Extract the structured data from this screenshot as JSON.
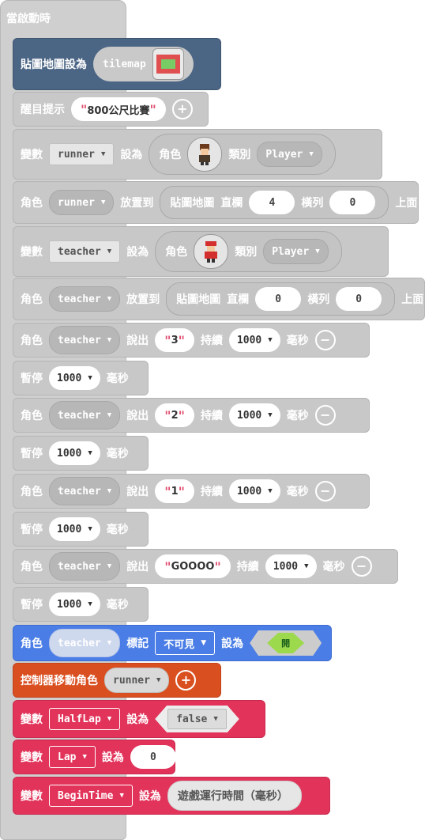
{
  "hat": {
    "label": "當啟動時"
  },
  "tilemap_block": {
    "label": "貼圖地圖設為",
    "value": "tilemap",
    "colors": {
      "tile": "#e05050",
      "center": "#77cc66"
    }
  },
  "title_block": {
    "label": "醒目提示",
    "text": "800公尺比賽"
  },
  "runner_set": {
    "var_label": "變數",
    "var": "runner",
    "set_label": "設為",
    "sprite_label": "角色",
    "kind_label": "類別",
    "kind": "Player"
  },
  "runner_place": {
    "sprite_label": "角色",
    "var": "runner",
    "place_label": "放置到",
    "tilemap_label": "貼圖地圖",
    "col_label": "直欄",
    "col": "4",
    "row_label": "橫列",
    "row": "0",
    "top_label": "上面"
  },
  "teacher_set": {
    "var_label": "變數",
    "var": "teacher",
    "set_label": "設為",
    "sprite_label": "角色",
    "kind_label": "類別",
    "kind": "Player"
  },
  "teacher_place": {
    "sprite_label": "角色",
    "var": "teacher",
    "place_label": "放置到",
    "tilemap_label": "貼圖地圖",
    "col_label": "直欄",
    "col": "0",
    "row_label": "橫列",
    "row": "0",
    "top_label": "上面"
  },
  "say": [
    {
      "sprite_label": "角色",
      "var": "teacher",
      "say_label": "說出",
      "text": "3",
      "dur_label": "持續",
      "dur": "1000",
      "ms_label": "毫秒"
    },
    {
      "sprite_label": "角色",
      "var": "teacher",
      "say_label": "說出",
      "text": "2",
      "dur_label": "持續",
      "dur": "1000",
      "ms_label": "毫秒"
    },
    {
      "sprite_label": "角色",
      "var": "teacher",
      "say_label": "說出",
      "text": "1",
      "dur_label": "持續",
      "dur": "1000",
      "ms_label": "毫秒"
    },
    {
      "sprite_label": "角色",
      "var": "teacher",
      "say_label": "說出",
      "text": "GOOOO",
      "dur_label": "持續",
      "dur": "1000",
      "ms_label": "毫秒"
    }
  ],
  "pause": [
    {
      "label": "暫停",
      "value": "1000",
      "ms_label": "毫秒"
    },
    {
      "label": "暫停",
      "value": "1000",
      "ms_label": "毫秒"
    },
    {
      "label": "暫停",
      "value": "1000",
      "ms_label": "毫秒"
    },
    {
      "label": "暫停",
      "value": "1000",
      "ms_label": "毫秒"
    }
  ],
  "flag_block": {
    "sprite_label": "角色",
    "var": "teacher",
    "flag_label": "標記",
    "flag": "不可見",
    "set_label": "設為",
    "toggle": "開"
  },
  "controller_block": {
    "label": "控制器移動角色",
    "var": "runner"
  },
  "halflap_block": {
    "var_label": "變數",
    "var": "HalfLap",
    "set_label": "設為",
    "value": "false"
  },
  "lap_block": {
    "var_label": "變數",
    "var": "Lap",
    "set_label": "設為",
    "value": "0"
  },
  "begintime_block": {
    "var_label": "變數",
    "var": "BeginTime",
    "set_label": "設為",
    "value": "遊戲運行時間（毫秒）"
  }
}
